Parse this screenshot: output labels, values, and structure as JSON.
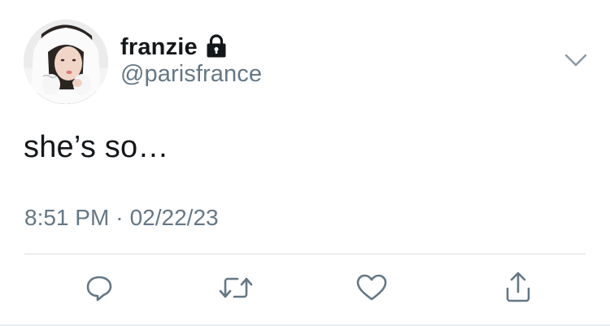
{
  "user": {
    "display_name": "franzie",
    "handle": "@parisfrance",
    "protected_icon": "lock-icon"
  },
  "tweet": {
    "text": "she’s so…",
    "time": "8:51 PM",
    "separator": "·",
    "date": "02/22/23"
  },
  "actions": {
    "reply_icon": "reply-icon",
    "retweet_icon": "retweet-icon",
    "like_icon": "heart-icon",
    "share_icon": "share-icon"
  },
  "colors": {
    "text_primary": "#14171a",
    "text_secondary": "#657786",
    "icon_gray": "#657786",
    "divider": "#d8dde1"
  }
}
